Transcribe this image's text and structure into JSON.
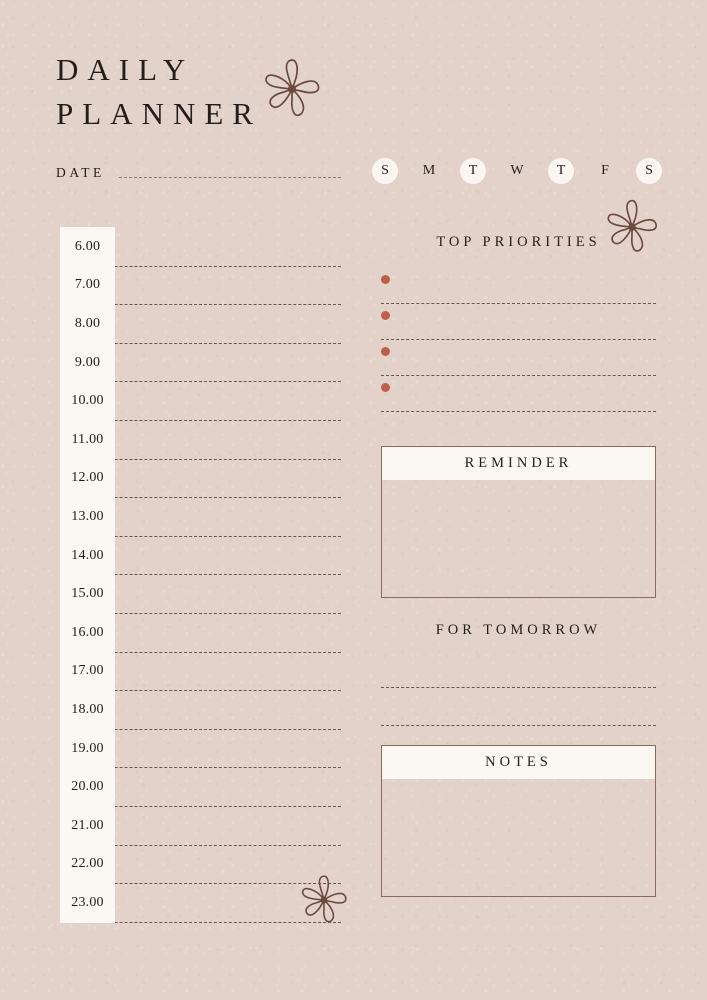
{
  "document": {
    "title_line_1": "DAILY",
    "title_line_2": "PLANNER",
    "background_color": "#e3d2ca",
    "accent_color": "#bd5f49",
    "ink_color": "#241d1a",
    "panel_header_color": "#fbf7f2",
    "rule_color": "#6a564c"
  },
  "date_field": {
    "label": "DATE",
    "value": "",
    "placeholder": ""
  },
  "weekdays": [
    {
      "letter": "S",
      "highlighted": true
    },
    {
      "letter": "M",
      "highlighted": false
    },
    {
      "letter": "T",
      "highlighted": true
    },
    {
      "letter": "W",
      "highlighted": false
    },
    {
      "letter": "T",
      "highlighted": true
    },
    {
      "letter": "F",
      "highlighted": false
    },
    {
      "letter": "S",
      "highlighted": true
    }
  ],
  "schedule": {
    "slots": [
      {
        "time": "6.00",
        "entry": ""
      },
      {
        "time": "7.00",
        "entry": ""
      },
      {
        "time": "8.00",
        "entry": ""
      },
      {
        "time": "9.00",
        "entry": ""
      },
      {
        "time": "10.00",
        "entry": ""
      },
      {
        "time": "11.00",
        "entry": ""
      },
      {
        "time": "12.00",
        "entry": ""
      },
      {
        "time": "13.00",
        "entry": ""
      },
      {
        "time": "14.00",
        "entry": ""
      },
      {
        "time": "15.00",
        "entry": ""
      },
      {
        "time": "16.00",
        "entry": ""
      },
      {
        "time": "17.00",
        "entry": ""
      },
      {
        "time": "18.00",
        "entry": ""
      },
      {
        "time": "19.00",
        "entry": ""
      },
      {
        "time": "20.00",
        "entry": ""
      },
      {
        "time": "21.00",
        "entry": ""
      },
      {
        "time": "22.00",
        "entry": ""
      },
      {
        "time": "23.00",
        "entry": ""
      }
    ]
  },
  "top_priorities": {
    "heading": "TOP PRIORITIES",
    "items": [
      {
        "value": ""
      },
      {
        "value": ""
      },
      {
        "value": ""
      },
      {
        "value": ""
      }
    ]
  },
  "reminder": {
    "heading": "REMINDER",
    "value": ""
  },
  "for_tomorrow": {
    "heading": "FOR TOMORROW",
    "lines": [
      {
        "value": ""
      },
      {
        "value": ""
      }
    ]
  },
  "notes": {
    "heading": "NOTES",
    "value": ""
  },
  "decorations": [
    {
      "name": "flower-top",
      "position": "header"
    },
    {
      "name": "flower-priorities",
      "position": "top-priorities"
    },
    {
      "name": "flower-bottom",
      "position": "schedule-footer"
    }
  ]
}
